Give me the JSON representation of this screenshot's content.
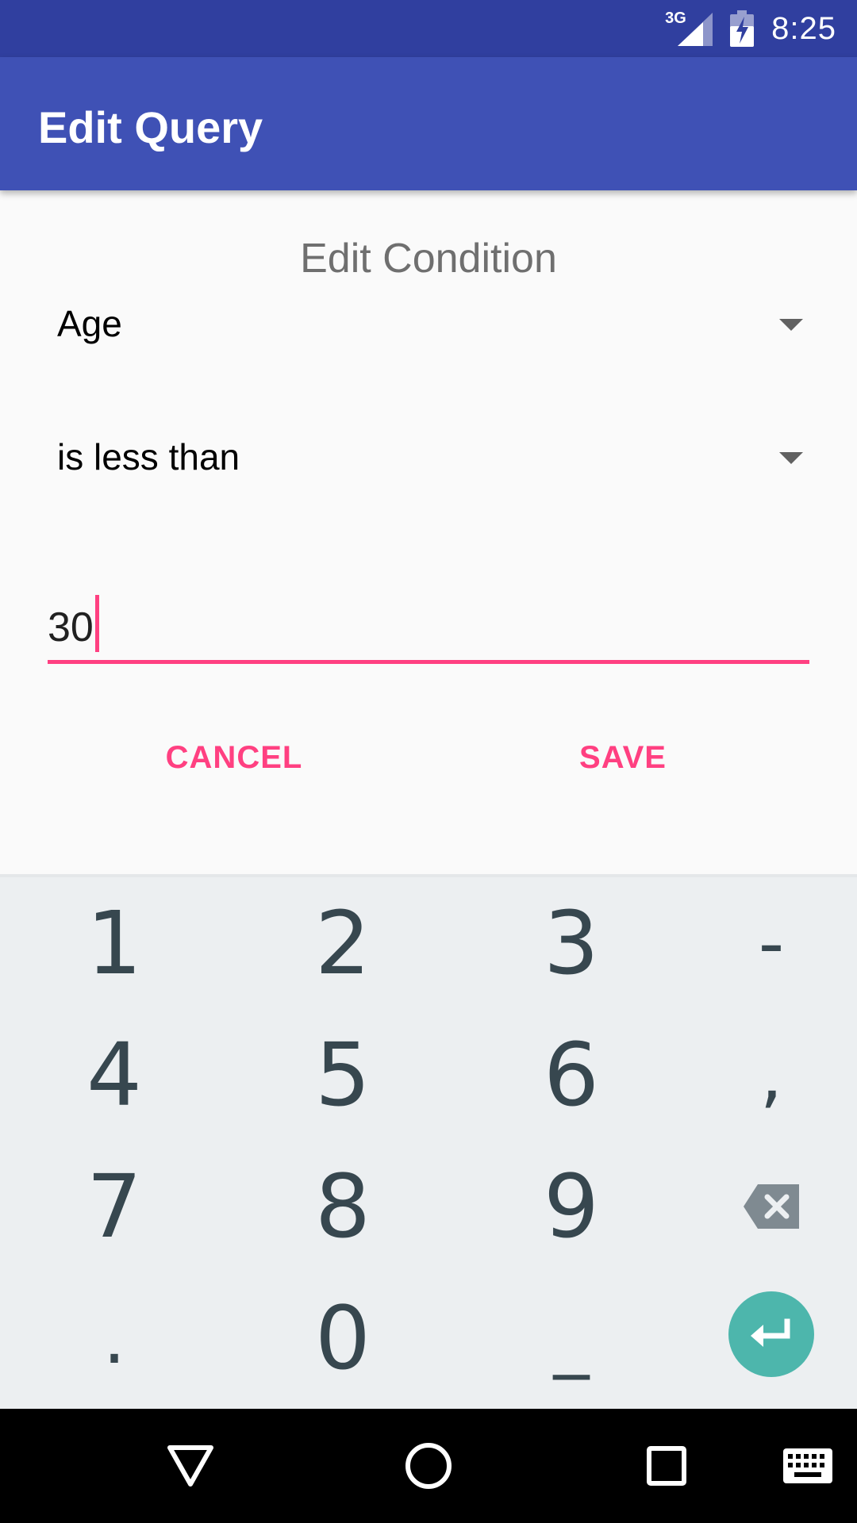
{
  "status_bar": {
    "network_label": "3G",
    "time": "8:25"
  },
  "app_bar": {
    "title": "Edit Query"
  },
  "dialog": {
    "title": "Edit Condition",
    "field_select": {
      "value": "Age"
    },
    "operator_select": {
      "value": "is less than"
    },
    "value_input": {
      "value": "30"
    },
    "cancel_label": "CANCEL",
    "save_label": "SAVE"
  },
  "keyboard": {
    "keys": [
      "1",
      "2",
      "3",
      "-",
      "4",
      "5",
      "6",
      ",",
      "7",
      "8",
      "9",
      ".",
      "0",
      "_"
    ]
  },
  "colors": {
    "status_bar": "#303f9f",
    "app_bar": "#3f51b5",
    "accent": "#ff4081",
    "enter_key": "#4db6ac",
    "key_text": "#37474f",
    "keyboard_bg": "#eceff1"
  },
  "icons": {
    "signal": "signal-icon",
    "battery": "battery-charging-icon",
    "dropdown": "dropdown-arrow-icon",
    "backspace": "backspace-icon",
    "enter": "enter-icon",
    "back": "back-triangle-icon",
    "home": "home-circle-icon",
    "recents": "recents-square-icon",
    "keyboard": "keyboard-icon"
  }
}
